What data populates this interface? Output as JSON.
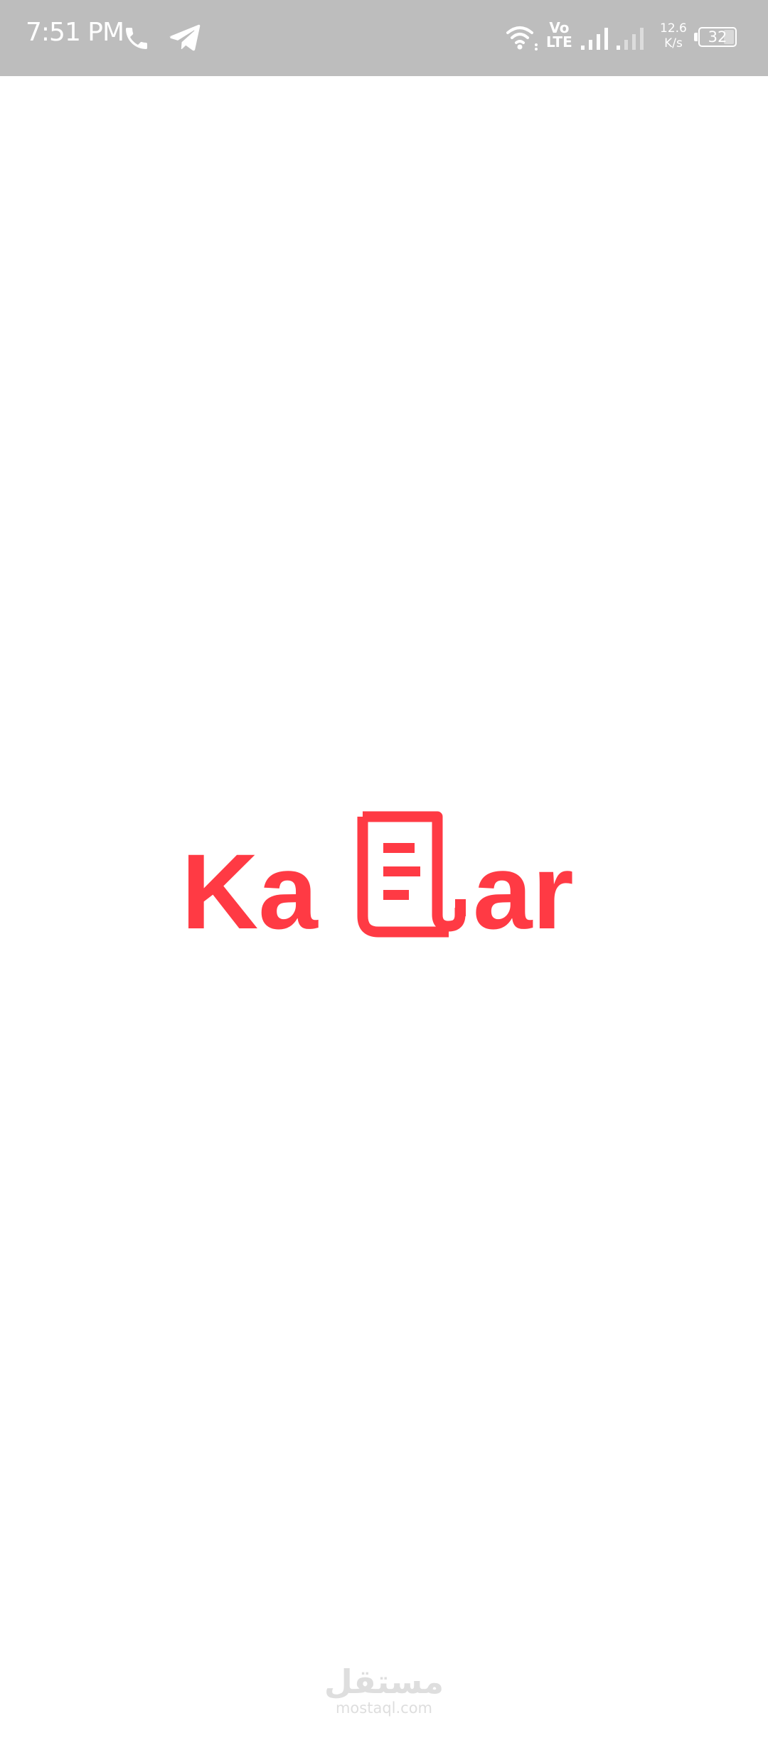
{
  "status_bar": {
    "time": "7:51 PM",
    "volte_top": "Vo",
    "volte_bottom": "LTE",
    "net_speed_value": "12.6",
    "net_speed_unit": "K/s",
    "battery_level": "32",
    "icons": [
      "phone-icon",
      "telegram-icon",
      "wifi-icon",
      "signal-icon",
      "battery-icon"
    ]
  },
  "logo": {
    "text_left": "Ka",
    "text_right": "ar",
    "icon": "document-icon",
    "color": "#ff3a44"
  },
  "watermark": {
    "arabic": "مستقل",
    "latin": "mostaql.com"
  },
  "colors": {
    "status_bar_bg": "#bdbdbd",
    "background": "#ffffff",
    "brand": "#ff3a44",
    "watermark": "#dedede"
  }
}
